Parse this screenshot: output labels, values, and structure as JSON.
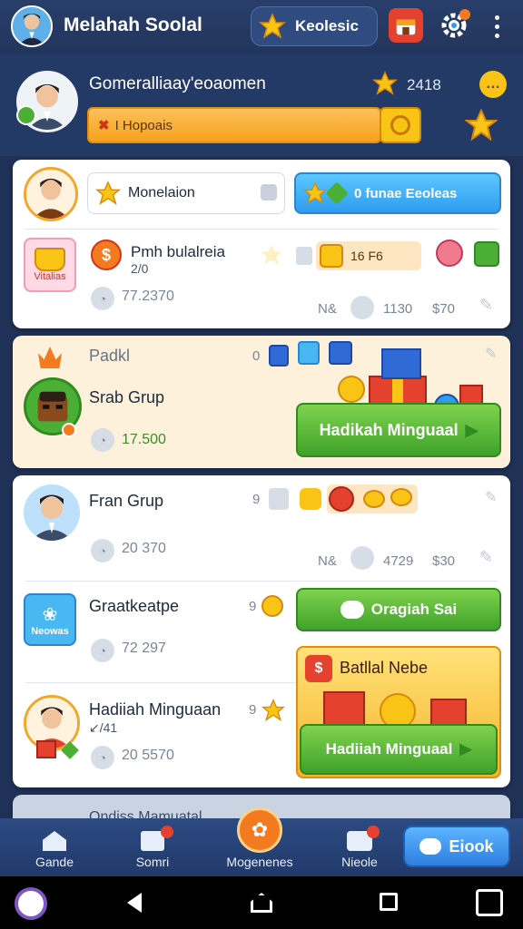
{
  "header": {
    "title": "Melahah Soolal",
    "pill_label": "Keolesic"
  },
  "profile": {
    "name": "Gomeralliaay'eoaomen",
    "score": "2418",
    "status_text": "I Hopoais"
  },
  "card_main": {
    "search_label": "Monelaion",
    "action_label": "0 funae Eeoleas",
    "item_title": "Pmh bulalreia",
    "item_sub": "2/0",
    "tile_label": "Vitalias",
    "chip_label": "16 F6",
    "stat_1": "77.2370",
    "stat_2_prefix": "N&",
    "stat_2": "1130",
    "stat_3": "$70"
  },
  "card_group": {
    "heading": "Padkl",
    "count": "0",
    "name": "Srab Grup",
    "amount": "17.500",
    "button": "Hadikah Minguaal"
  },
  "card_list": {
    "row1_title": "Fran Grup",
    "row1_count": "9",
    "row1_stat": "20 370",
    "row1_prefix": "N&",
    "row1_stat2": "4729",
    "row1_stat3": "$30",
    "row2_title": "Graatkeatpe",
    "row2_count": "9",
    "row2_tile": "Neowas",
    "row2_stat": "72 297",
    "row2_button": "Oragiah Sai",
    "row3_title": "Hadiiah Minguaan",
    "row3_sub": "↙/41",
    "row3_count": "9",
    "row3_stat": "20 5570",
    "promo_title": "Batllal Nebe",
    "promo_button": "Hadiiah Minguaal"
  },
  "peek_card": {
    "title": "Ondiss Mamuatal"
  },
  "nav": {
    "items": [
      "Gande",
      "Somri",
      "Mogenenes",
      "Nieole"
    ],
    "cta": "Eiook"
  },
  "colors": {
    "accent_orange": "#f47a20",
    "accent_green": "#4caf35",
    "accent_blue": "#2f9cf0",
    "badge_red": "#e4412f"
  }
}
